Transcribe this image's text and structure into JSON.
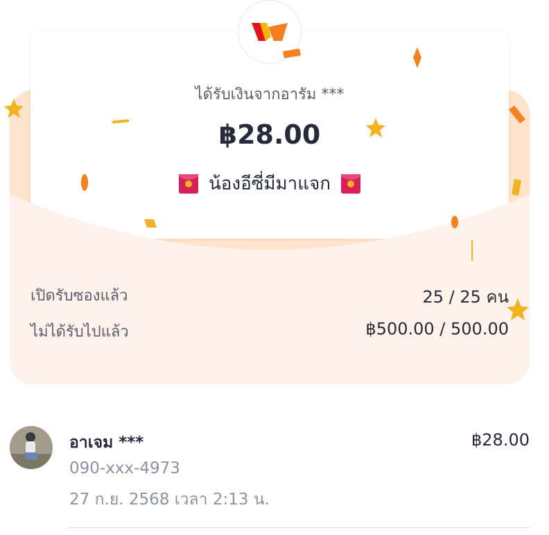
{
  "header": {
    "logo_icon": "brand-logo-icon",
    "from_text": "ได้รับเงินจากอารัม ***",
    "amount": "฿28.00",
    "title": "น้องอีซี่มีมาแจก",
    "title_icon": "red-envelope-icon"
  },
  "stats": {
    "opened_label": "เปิดรับซองแล้ว",
    "opened_value": "25 / 25 คน",
    "received_label": "ไม่ได้รับไปแล้ว",
    "received_value": "฿500.00 / 500.00"
  },
  "entries": [
    {
      "name": "อาเจม ***",
      "phone": "090-xxx-4973",
      "time": "27 ก.ย. 2568 เวลา 2:13 น.",
      "amount": "฿28.00"
    }
  ],
  "colors": {
    "accent_orange": "#f5821f",
    "confetti_yellow": "#f5b21f",
    "envelope_peach": "#ffe3cc",
    "envelope_front": "#fff2ea",
    "red_envelope": "#d81f5a"
  }
}
